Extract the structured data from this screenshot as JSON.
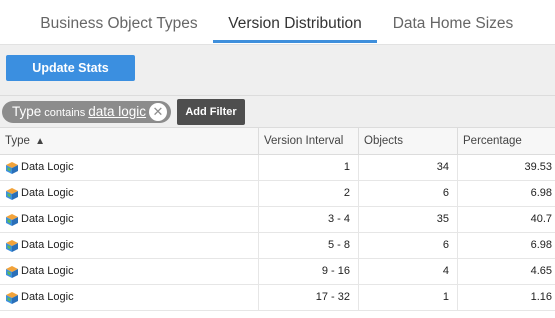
{
  "tabs": [
    {
      "label": "Business Object Types"
    },
    {
      "label": "Version Distribution",
      "active": true
    },
    {
      "label": "Data Home Sizes"
    }
  ],
  "toolbar": {
    "update_label": "Update Stats"
  },
  "filter": {
    "field": "Type",
    "operator": "contains",
    "value": "data logic",
    "close_glyph": "✕",
    "add_label": "Add Filter"
  },
  "table": {
    "columns": [
      "Type",
      "Version Interval",
      "Objects",
      "Percentage"
    ],
    "sort": {
      "column": "Type",
      "direction": "ascending",
      "glyph": "▲"
    },
    "rows": [
      {
        "type": "Data Logic",
        "interval": "1",
        "objects": "34",
        "percentage": "39.53"
      },
      {
        "type": "Data Logic",
        "interval": "2",
        "objects": "6",
        "percentage": "6.98"
      },
      {
        "type": "Data Logic",
        "interval": "3 - 4",
        "objects": "35",
        "percentage": "40.7"
      },
      {
        "type": "Data Logic",
        "interval": "5 - 8",
        "objects": "6",
        "percentage": "6.98"
      },
      {
        "type": "Data Logic",
        "interval": "9 - 16",
        "objects": "4",
        "percentage": "4.65"
      },
      {
        "type": "Data Logic",
        "interval": "17 - 32",
        "objects": "1",
        "percentage": "1.16"
      }
    ],
    "row_icon": "data-logic-icon"
  },
  "colors": {
    "accent": "#3f8fdc",
    "update_button": "#3b8fe0",
    "filter_chip": "#8c8c8c",
    "add_filter_button": "#4e4e4e"
  }
}
